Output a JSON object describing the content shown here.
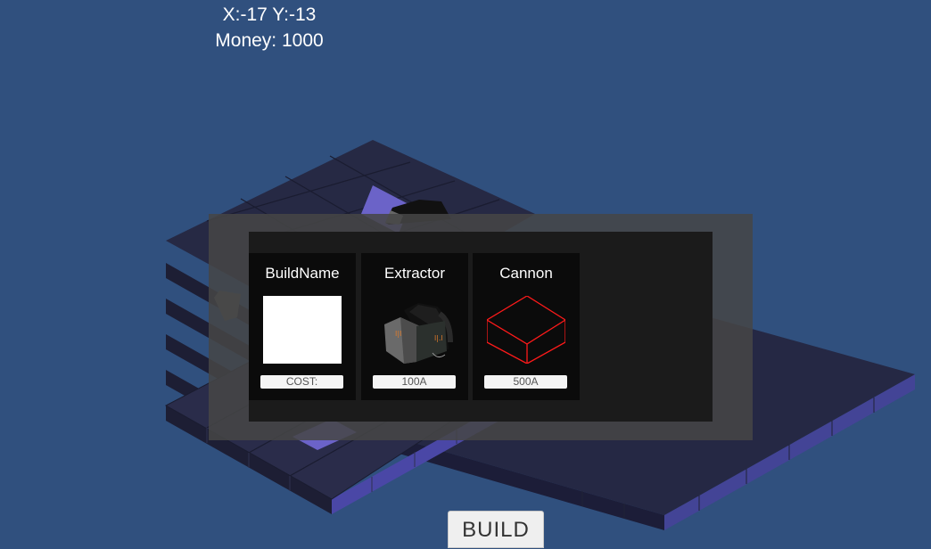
{
  "hud": {
    "coords": "X:-17 Y:-13",
    "money": "Money: 1000"
  },
  "build_menu": {
    "cards": [
      {
        "title": "BuildName",
        "cost": "COST:",
        "icon": "blank-preview"
      },
      {
        "title": "Extractor",
        "cost": "100A",
        "icon": "extractor-icon"
      },
      {
        "title": "Cannon",
        "cost": "500A",
        "icon": "cannon-wireframe-icon"
      }
    ]
  },
  "build_button": {
    "label": "BUILD"
  },
  "colors": {
    "background": "#30507e",
    "tile_dark": "#262a46",
    "tile_highlight": "#6b63c8",
    "cannon_wireframe": "#ff1a1a"
  }
}
